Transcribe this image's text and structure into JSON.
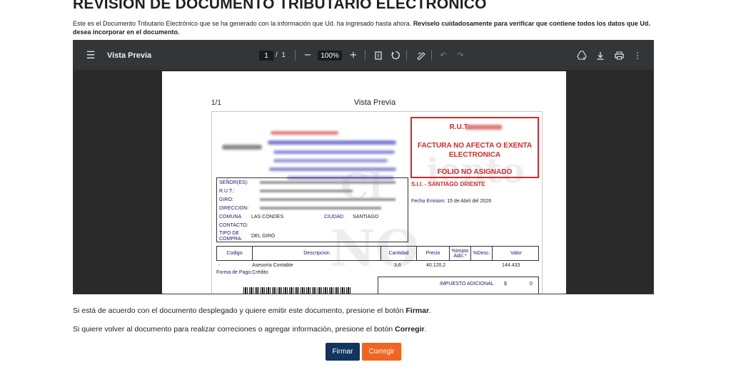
{
  "page": {
    "title": "REVISIÓN DE DOCUMENTO TRIBUTARIO ELECTRÓNICO",
    "intro_text": "Este es el Documento Tributario Electrónico que se ha generado con la información que Ud. ha ingresado hasta ahora.",
    "intro_bold": "Revíselo cuidadosamente para verificar que contiene todos los datos que Ud. desea incorporar en el documento."
  },
  "viewer": {
    "title": "Vista Previa",
    "page_current": "1",
    "page_separator": "/",
    "page_total": "1",
    "zoom": "100%",
    "zoom_out": "−",
    "zoom_in": "+"
  },
  "document": {
    "page_count": "1/1",
    "heading": "Vista Previa",
    "rut_label": "R.U.T.:",
    "doc_type": "FACTURA NO AFECTA O EXENTA ELECTRONICA",
    "folio": "FOLIO NO ASIGNADO",
    "sii": "S.I.I. - SANTIAGO ORIENTE",
    "fecha_label": "Fecha Emision:",
    "fecha_value": "15 de Abril del 2026",
    "client": {
      "senor_label": "SEÑOR(ES):",
      "rut_label": "R.U.T.:",
      "giro_label": "GIRO:",
      "direccion_label": "DIRECCION:",
      "comuna_label": "COMUNA",
      "comuna_value": "LAS CONDES",
      "ciudad_label": "CIUDAD:",
      "ciudad_value": "SANTIAGO",
      "contacto_label": "CONTACTO:",
      "tipo_compra_label": "TIPO DE COMPRA:",
      "tipo_compra_value": "DEL GIRO"
    },
    "columns": [
      "Codigo",
      "Descripcion",
      "Cantidad",
      "Precio",
      "%Impto Adic.*",
      "%Desc.",
      "Valor"
    ],
    "rows": [
      {
        "codigo": "-",
        "descripcion": "Asesoría Contable",
        "cantidad": "3,6",
        "precio": "40.120,2",
        "valor": "144.433"
      }
    ],
    "forma_pago_label": "Forma de Pago:",
    "forma_pago_value": "Crédito",
    "impuesto_label": "IMPUESTO ADICIONAL",
    "impuesto_currency": "$",
    "impuesto_value": "0"
  },
  "footer": {
    "msg1_text": "Si está de acuerdo con el documento desplegado y quiere emitir este documento, presione el botón",
    "msg1_bold": "Firmar",
    "msg2_text": "Si quiere volver al documento para realizar correciones o agregar información, presione el botón",
    "msg2_bold": "Corregir",
    "firmar_label": "Firmar",
    "corregir_label": "Corregir"
  },
  "icons": {
    "menu": "menu-icon",
    "fit_page": "fit-page-icon",
    "rotate": "rotate-icon",
    "annotate": "annotate-icon",
    "undo": "undo-icon",
    "redo": "redo-icon",
    "drive": "save-to-drive-icon",
    "download": "download-icon",
    "print": "print-icon",
    "more": "more-options-icon"
  },
  "colors": {
    "firmar_button": "#12355b",
    "corregir_button": "#ef6624",
    "document_red": "#d12a2a",
    "document_label_blue": "#1a1a66",
    "toolbar": "#323639"
  }
}
